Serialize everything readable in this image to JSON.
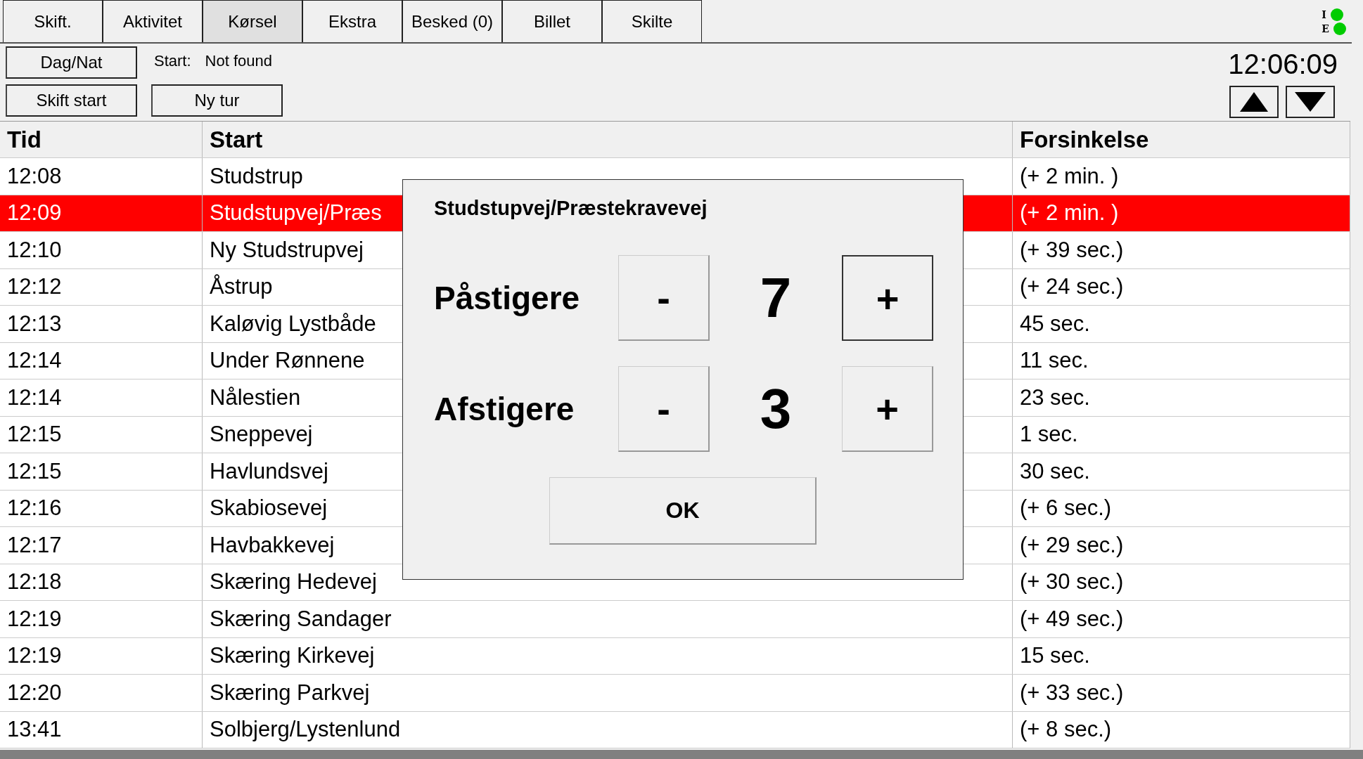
{
  "tabs": [
    {
      "label": "Skift.",
      "selected": false
    },
    {
      "label": "Aktivitet",
      "selected": false
    },
    {
      "label": "Kørsel",
      "selected": true
    },
    {
      "label": "Ekstra",
      "selected": false
    },
    {
      "label": "Besked (0)",
      "selected": false
    },
    {
      "label": "Billet",
      "selected": false
    },
    {
      "label": "Skilte",
      "selected": false
    }
  ],
  "indicators": [
    {
      "label": "I",
      "color": "#00cc00"
    },
    {
      "label": "E",
      "color": "#00cc00"
    }
  ],
  "buttons": {
    "day_night": "Dag/Nat",
    "shift_start": "Skift start",
    "new_trip": "Ny tur"
  },
  "start": {
    "label": "Start:",
    "value": "Not found"
  },
  "clock": "12:06:09",
  "table": {
    "columns": [
      "Tid",
      "Start",
      "Forsinkelse"
    ],
    "rows": [
      {
        "time": "12:08",
        "start": "Studstrup",
        "delay": "(+ 2 min. )",
        "selected": false
      },
      {
        "time": "12:09",
        "start": "Studstupvej/Præs",
        "delay": "(+ 2 min. )",
        "selected": true
      },
      {
        "time": "12:10",
        "start": "Ny Studstrupvej",
        "delay": "(+ 39 sec.)",
        "selected": false
      },
      {
        "time": "12:12",
        "start": "Åstrup",
        "delay": "(+ 24 sec.)",
        "selected": false
      },
      {
        "time": "12:13",
        "start": "Kaløvig Lystbåde",
        "delay": "45 sec.",
        "selected": false
      },
      {
        "time": "12:14",
        "start": "Under Rønnene",
        "delay": "11 sec.",
        "selected": false
      },
      {
        "time": "12:14",
        "start": "Nålestien",
        "delay": "23 sec.",
        "selected": false
      },
      {
        "time": "12:15",
        "start": "Sneppevej",
        "delay": "1 sec.",
        "selected": false
      },
      {
        "time": "12:15",
        "start": "Havlundsvej",
        "delay": "30 sec.",
        "selected": false
      },
      {
        "time": "12:16",
        "start": "Skabiosevej",
        "delay": "(+ 6 sec.)",
        "selected": false
      },
      {
        "time": "12:17",
        "start": "Havbakkevej",
        "delay": "(+ 29 sec.)",
        "selected": false
      },
      {
        "time": "12:18",
        "start": "Skæring Hedevej",
        "delay": "(+ 30 sec.)",
        "selected": false
      },
      {
        "time": "12:19",
        "start": "Skæring Sandager",
        "delay": "(+ 49 sec.)",
        "selected": false
      },
      {
        "time": "12:19",
        "start": "Skæring Kirkevej",
        "delay": "15 sec.",
        "selected": false
      },
      {
        "time": "12:20",
        "start": "Skæring Parkvej",
        "delay": "(+ 33 sec.)",
        "selected": false
      },
      {
        "time": "13:41",
        "start": "Solbjerg/Lystenlund",
        "delay": "(+ 8 sec.)",
        "selected": false
      }
    ]
  },
  "dialog": {
    "title": "Studstupvej/Præstekravevej",
    "counters": [
      {
        "label": "Påstigere",
        "minus": "-",
        "value": "7",
        "plus": "+",
        "plus_focused": true
      },
      {
        "label": "Afstigere",
        "minus": "-",
        "value": "3",
        "plus": "+",
        "plus_focused": false
      }
    ],
    "ok": "OK"
  }
}
